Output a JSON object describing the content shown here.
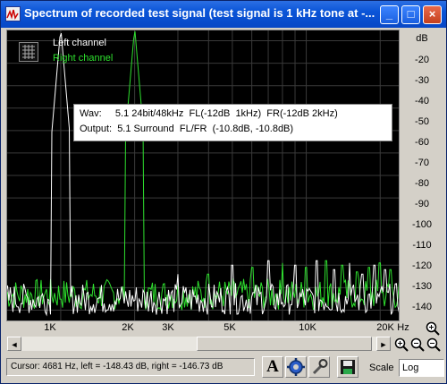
{
  "window": {
    "title": "Spectrum of recorded test signal (test signal is 1 kHz tone at -...",
    "minimize_glyph": "_",
    "maximize_glyph": "□",
    "close_glyph": "×"
  },
  "legend": {
    "left_label": "Left channel",
    "right_label": "Right channel",
    "left_color": "#ffffff",
    "right_color": "#2ee02e"
  },
  "info": {
    "line1": "Wav:     5.1 24bit/48kHz  FL(-12dB  1kHz)  FR(-12dB 2kHz)",
    "line2": "Output:  5.1 Surround  FL/FR  (-10.8dB, -10.8dB)"
  },
  "axes": {
    "y_unit": "dB",
    "y_ticks": [
      "-20",
      "-30",
      "-40",
      "-50",
      "-60",
      "-70",
      "-80",
      "-90",
      "-100",
      "-110",
      "-120",
      "-130",
      "-140"
    ],
    "x_ticks": [
      "1K",
      "2K",
      "3K",
      "5K",
      "10K",
      "20K"
    ],
    "x_unit": "Hz"
  },
  "chart_data": {
    "type": "line",
    "xlabel": "Hz",
    "ylabel": "dB",
    "x_scale": "log",
    "ylim": [
      -145,
      -10
    ],
    "series": [
      {
        "name": "Left channel",
        "color": "#ffffff",
        "peak_hz": 1000,
        "peak_db": -14,
        "noise_floor_db": -135
      },
      {
        "name": "Right channel",
        "color": "#2ee02e",
        "peak_hz": 2000,
        "peak_db": -14,
        "noise_floor_db": -133
      }
    ]
  },
  "scrollbar": {
    "left_arrow": "◄",
    "right_arrow": "►"
  },
  "status": {
    "cursor_text": "Cursor:  4681 Hz,  left = -148.43 dB,  right = -146.73 dB"
  },
  "toolbar": {
    "font_button": "A",
    "scale_label": "Scale",
    "scale_value": "Log"
  },
  "zoom": {
    "zoom_in": "+",
    "zoom_out": "−"
  }
}
